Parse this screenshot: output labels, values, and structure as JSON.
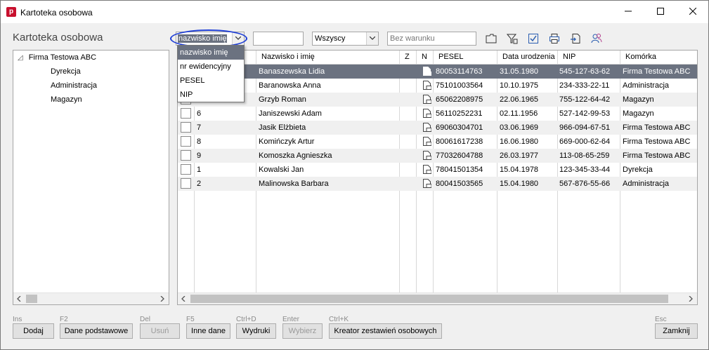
{
  "window": {
    "title": "Kartoteka osobowa",
    "app_icon_letter": "p"
  },
  "heading": "Kartoteka osobowa",
  "search_field": {
    "selected": "nazwisko imię",
    "options": [
      "nazwisko imię",
      "nr ewidencyjny",
      "PESEL",
      "NIP"
    ]
  },
  "search_input": {
    "value": ""
  },
  "filter_combo": {
    "selected": "Wszyscy"
  },
  "condition_input": {
    "placeholder": "Bez warunku"
  },
  "toolbar_icons": [
    "folder-icon",
    "filter-icon",
    "checkbox-icon",
    "printer-icon",
    "export-icon",
    "users-icon"
  ],
  "tree": {
    "root": {
      "expander": "◿",
      "label": "Firma Testowa ABC"
    },
    "children": [
      "Dyrekcja",
      "Administracja",
      "Magazyn"
    ]
  },
  "grid": {
    "columns": [
      "",
      "",
      "Nazwisko i imię",
      "Z",
      "N",
      "PESEL",
      "Data urodzenia",
      "NIP",
      "Komórka"
    ],
    "rows": [
      {
        "id": "",
        "name": "Banaszewska Lidia",
        "pesel": "80053114763",
        "birth": "31.05.1980",
        "nip": "545-127-63-62",
        "unit": "Firma Testowa ABC",
        "selected": true
      },
      {
        "id": "",
        "name": "Baranowska Anna",
        "pesel": "75101003564",
        "birth": "10.10.1975",
        "nip": "234-333-22-11",
        "unit": "Administracja"
      },
      {
        "id": "",
        "name": "Grzyb Roman",
        "pesel": "65062208975",
        "birth": "22.06.1965",
        "nip": "755-122-64-42",
        "unit": "Magazyn"
      },
      {
        "id": "6",
        "name": "Janiszewski Adam",
        "pesel": "56110252231",
        "birth": "02.11.1956",
        "nip": "527-142-99-53",
        "unit": "Magazyn"
      },
      {
        "id": "7",
        "name": "Jasik Elżbieta",
        "pesel": "69060304701",
        "birth": "03.06.1969",
        "nip": "966-094-67-51",
        "unit": "Firma Testowa ABC"
      },
      {
        "id": "8",
        "name": "Komińczyk Artur",
        "pesel": "80061617238",
        "birth": "16.06.1980",
        "nip": "669-000-62-64",
        "unit": "Firma Testowa ABC"
      },
      {
        "id": "9",
        "name": "Komoszka Agnieszka",
        "pesel": "77032604788",
        "birth": "26.03.1977",
        "nip": "113-08-65-259",
        "unit": "Firma Testowa ABC"
      },
      {
        "id": "1",
        "name": "Kowalski Jan",
        "pesel": "78041501354",
        "birth": "15.04.1978",
        "nip": "123-345-33-44",
        "unit": "Dyrekcja"
      },
      {
        "id": "2",
        "name": "Malinowska Barbara",
        "pesel": "80041503565",
        "birth": "15.04.1980",
        "nip": "567-876-55-66",
        "unit": "Administracja"
      }
    ]
  },
  "buttons": [
    {
      "shortcut": "Ins",
      "label": "Dodaj",
      "enabled": true
    },
    {
      "shortcut": "F2",
      "label": "Dane podstawowe",
      "enabled": true
    },
    {
      "shortcut": "Del",
      "label": "Usuń",
      "enabled": false
    },
    {
      "shortcut": "F5",
      "label": "Inne dane",
      "enabled": true
    },
    {
      "shortcut": "Ctrl+D",
      "label": "Wydruki",
      "enabled": true
    },
    {
      "shortcut": "Enter",
      "label": "Wybierz",
      "enabled": false
    },
    {
      "shortcut": "Ctrl+K",
      "label": "Kreator zestawień osobowych",
      "enabled": true
    },
    {
      "shortcut": "Esc",
      "label": "Zamknij",
      "enabled": true
    }
  ],
  "colors": {
    "selection": "#6b7280",
    "highlight_ellipse": "#1f3fd6",
    "app_icon": "#c8102e"
  }
}
